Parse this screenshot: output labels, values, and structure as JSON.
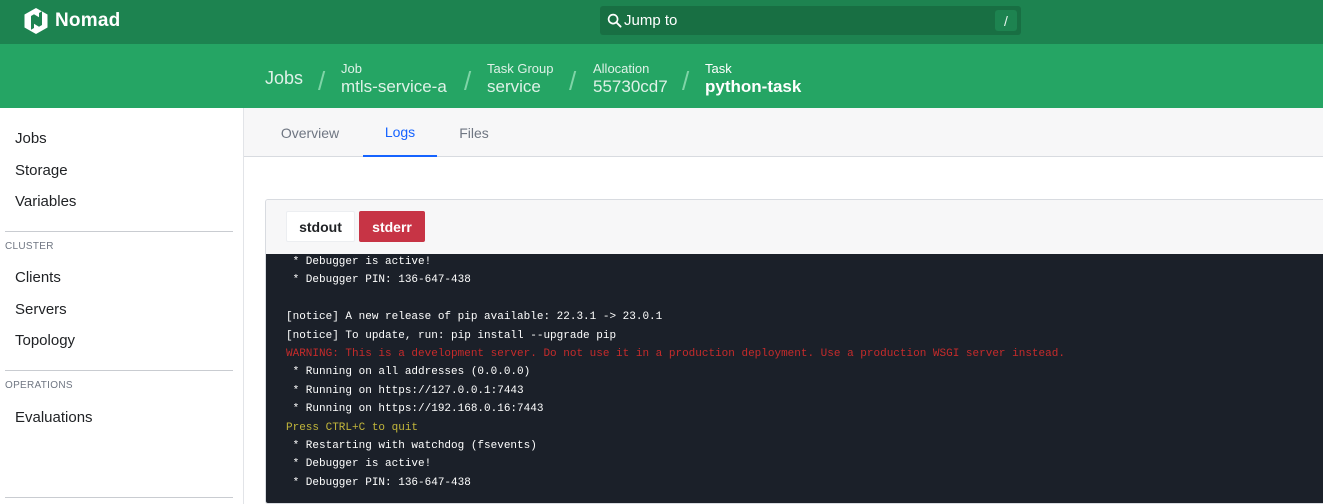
{
  "app": {
    "name": "Nomad",
    "search_placeholder": "Jump to",
    "search_shortcut": "/"
  },
  "breadcrumbs": {
    "root": "Jobs",
    "job": {
      "label": "Job",
      "value": "mtls-service-a"
    },
    "task_group": {
      "label": "Task Group",
      "value": "service"
    },
    "allocation": {
      "label": "Allocation",
      "value": "55730cd7"
    },
    "task": {
      "label": "Task",
      "value": "python-task"
    }
  },
  "sidebar": {
    "items_top": [
      "Jobs",
      "Storage",
      "Variables"
    ],
    "cluster_heading": "CLUSTER",
    "cluster_items": [
      "Clients",
      "Servers",
      "Topology"
    ],
    "operations_heading": "OPERATIONS",
    "operations_items": [
      "Evaluations"
    ]
  },
  "tabs": [
    "Overview",
    "Logs",
    "Files"
  ],
  "active_tab": "Logs",
  "logs": {
    "stdout_label": "stdout",
    "stderr_label": "stderr",
    "active_stream": "stderr",
    "lines": [
      {
        "text": " * Debugger is active!",
        "color": "white"
      },
      {
        "text": " * Debugger PIN: 136-647-438",
        "color": "white"
      },
      {
        "text": "",
        "color": "white"
      },
      {
        "text": "[notice] A new release of pip available: 22.3.1 -> 23.0.1",
        "color": "white"
      },
      {
        "text": "[notice] To update, run: pip install --upgrade pip",
        "color": "white"
      },
      {
        "text": "WARNING: This is a development server. Do not use it in a production deployment. Use a production WSGI server instead.",
        "color": "red"
      },
      {
        "text": " * Running on all addresses (0.0.0.0)",
        "color": "white"
      },
      {
        "text": " * Running on https://127.0.0.1:7443",
        "color": "white"
      },
      {
        "text": " * Running on https://192.168.0.16:7443",
        "color": "white"
      },
      {
        "text": "Press CTRL+C to quit",
        "color": "yellow"
      },
      {
        "text": " * Restarting with watchdog (fsevents)",
        "color": "white"
      },
      {
        "text": " * Debugger is active!",
        "color": "white"
      },
      {
        "text": " * Debugger PIN: 136-647-438",
        "color": "white"
      }
    ]
  },
  "colors": {
    "topbar": "#1d8350",
    "crumbbar": "#25a564",
    "active_tab": "#1563ff",
    "stderr_button": "#c73445",
    "log_background": "#1b2029",
    "warning_text": "#c62b2b",
    "notice_text": "#c2b63b"
  }
}
